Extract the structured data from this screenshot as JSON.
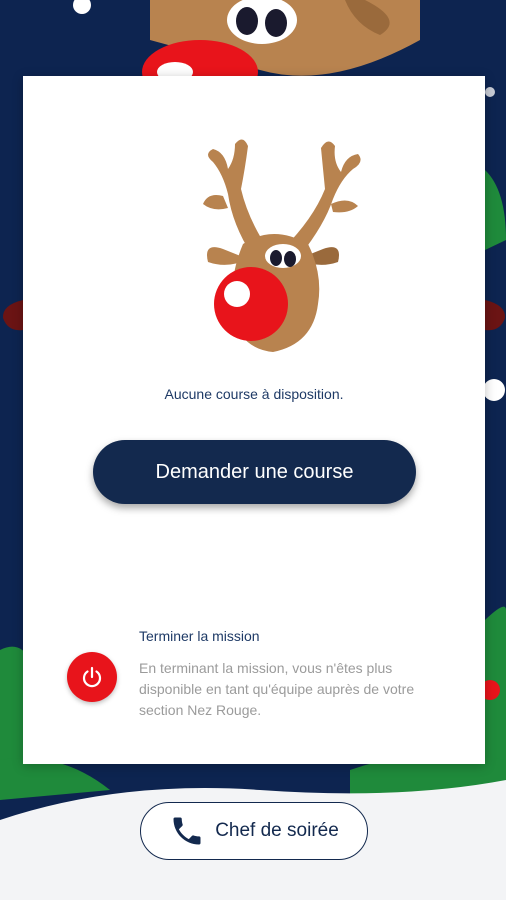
{
  "status": {
    "no_course": "Aucune course à disposition."
  },
  "actions": {
    "request_course_label": "Demander une course"
  },
  "end_mission": {
    "title": "Terminer la mission",
    "description": "En terminant la mission, vous n'êtes plus disponible en tant qu'équipe auprès de votre section Nez Rouge.",
    "icon": "power-icon"
  },
  "footer": {
    "chef_label": "Chef de soirée",
    "icon": "phone-icon"
  },
  "colors": {
    "navy": "#13294e",
    "red": "#e8141b",
    "background": "#0d2450",
    "reindeer_brown": "#b8834f"
  }
}
